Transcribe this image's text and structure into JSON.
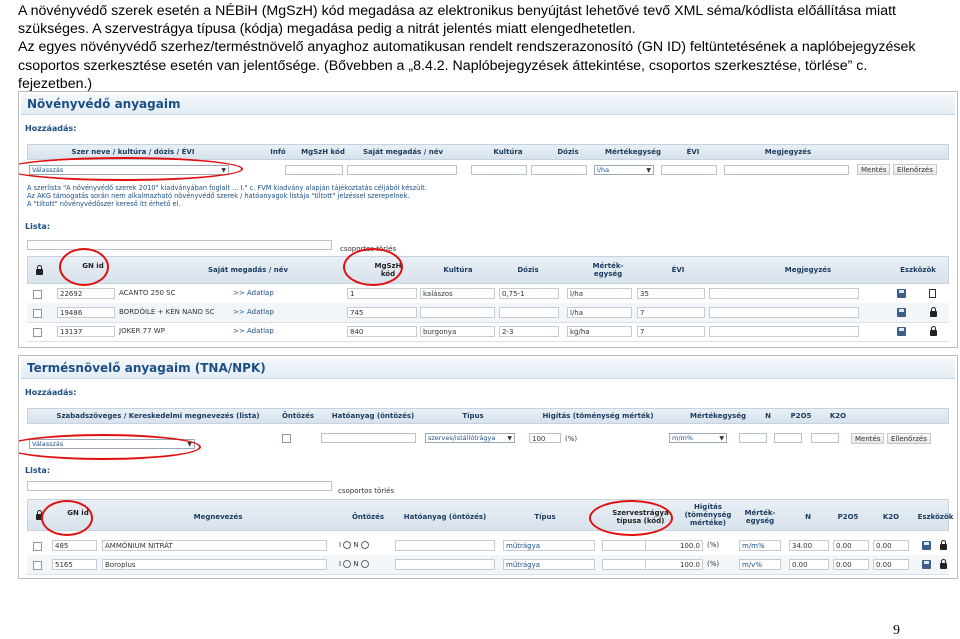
{
  "paragraphs": [
    "A növényvédő szerek esetén a NÉBiH (MgSzH) kód megadása az elektronikus benyújtást lehetővé tevő XML séma/kódlista előállítása miatt szükséges. A szervestrágya típusa (kódja) megadása pedig a nitrát jelentés miatt elengedhetetlen.",
    "Az egyes növényvédő szerhez/terméstnövelő anyaghoz automatikusan rendelt rendszerazonosító (GN ID) feltüntetésének a naplóbejegyzések csoportos szerkesztése esetén van jelentősége. (Bővebben a „8.4.2. Naplóbejegyzések áttekintése, csoportos szerkesztése, törlése” c. fejezetben.)"
  ],
  "page_number": "9",
  "panel1": {
    "title": "Növényvédő anyagaim",
    "add_label": "Hozzáadás:",
    "add_headers": [
      "Szer neve / kultúra / dózis / ÉVI",
      "Infó",
      "MgSzH kód",
      "Saját megadás / név",
      "Kultúra",
      "Dózis",
      "Mértékegység",
      "ÉVI",
      "Megjegyzés"
    ],
    "select_placeholder": "Válasszás",
    "unit_value": "l/ha",
    "save_label": "Mentés",
    "check_label": "Ellenőrzés",
    "note_lines": [
      "A szerlista \"A növényvédő szerek 2010\" kiadványában foglalt ... I.\" c. FVM kiadvány alapján tájékoztatás céljából készült.",
      "Az AKG támogatás során nem alkalmazható növényvédő szerek / hatóanyagok listája \"tiltott\" jelzéssel szerepelnek.",
      "A \"tiltott\" növényvédőszer kereső itt érhető el."
    ],
    "list_label": "Lista:",
    "group_delete": "csoportos törlés",
    "list_headers": [
      "GN id",
      "Saját megadás / név",
      "MgSzH kód",
      "Kultúra",
      "Dózis",
      "Mérték-egység",
      "ÉVI",
      "Megjegyzés",
      "Eszközök"
    ],
    "rows": [
      {
        "id": "22692",
        "name": "ACANTO 250 SC",
        "link": ">> Adatlap",
        "code": "1",
        "culture": "kalászos",
        "dose": "0,75-1",
        "unit": "l/ha",
        "evi": "35"
      },
      {
        "id": "19486",
        "name": "BORDÓILÉ + KÉN NANO SC",
        "link": ">> Adatlap",
        "code": "745",
        "culture": "",
        "dose": "",
        "unit": "l/ha",
        "evi": "7"
      },
      {
        "id": "13137",
        "name": "JOKER 77 WP",
        "link": ">> Adatlap",
        "code": "840",
        "culture": "burgonya",
        "dose": "2-3",
        "unit": "kg/ha",
        "evi": "7"
      }
    ]
  },
  "panel2": {
    "title": "Termésnövelő anyagaim (TNA/NPK)",
    "add_label": "Hozzáadás:",
    "add_headers": [
      "Szabadszöveges / Kereskedelmi megnevezés (lista)",
      "Öntözés",
      "Hatóanyag (öntözés)",
      "Típus",
      "Higítás (töménység mérték)",
      "Mértékegység",
      "N",
      "P2O5",
      "K2O"
    ],
    "select_placeholder": "Válasszás",
    "type_value": "szerves/istállótrágya",
    "dilution_value": "100",
    "percent": "(%)",
    "unit_value": "m/m%",
    "save_label": "Mentés",
    "check_label": "Ellenőrzés",
    "list_label": "Lista:",
    "group_delete": "csoportos törlés",
    "list_headers": [
      "GN id",
      "Megnevezés",
      "Öntözés",
      "Hatóanyag (öntözés)",
      "Típus",
      "Szervestrágya típusa (kód)",
      "Higítás (töménység mértéke)",
      "Mérték-egység",
      "N",
      "P2O5",
      "K2O",
      "Eszközök"
    ],
    "rows": [
      {
        "id": "485",
        "name": "AMMÓNIUM NITRÁT",
        "i": "I",
        "n": "N",
        "type": "műtrágya",
        "dilution": "100.0",
        "pct": "(%)",
        "unit": "m/m%",
        "N": "34.00",
        "P": "0.00",
        "K": "0.00"
      },
      {
        "id": "5165",
        "name": "Boroplus",
        "i": "I",
        "n": "N",
        "type": "műtrágya",
        "dilution": "100.0",
        "pct": "(%)",
        "unit": "m/v%",
        "N": "0.00",
        "P": "0.00",
        "K": "0.00"
      }
    ]
  },
  "colors": {
    "annotation_red": "#e01010",
    "header_blue": "#1c4f86"
  }
}
